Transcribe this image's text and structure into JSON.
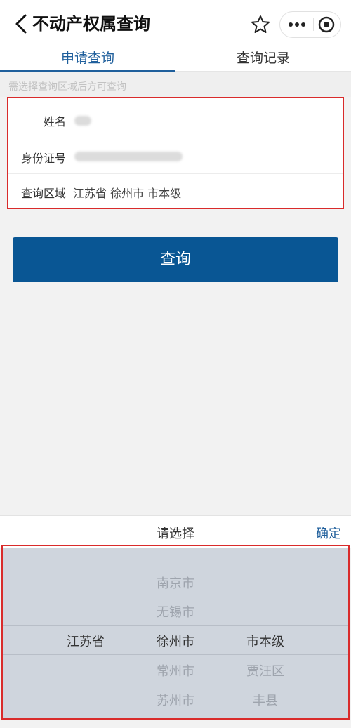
{
  "nav": {
    "title": "不动产权属查询",
    "back_icon": "back-arrow-icon",
    "favorite_icon": "star-icon",
    "more_icon": "more-dots-icon",
    "close_icon": "target-close-icon"
  },
  "tabs": [
    {
      "label": "申请查询",
      "active": true
    },
    {
      "label": "查询记录",
      "active": false
    }
  ],
  "hint": "需选择查询区域后方可查询",
  "form": {
    "name_label": "姓名",
    "id_label": "身份证号",
    "region_label": "查询区域",
    "region_value": "江苏省 徐州市 市本级"
  },
  "query_button": "查询",
  "picker": {
    "title": "请选择",
    "confirm": "确定",
    "col1": [
      "江苏省"
    ],
    "col2": [
      "南京市",
      "无锡市",
      "徐州市",
      "常州市",
      "苏州市"
    ],
    "col3": [
      "市本级",
      "贾汪区",
      "丰县"
    ]
  },
  "colors": {
    "accent": "#1f5f9c",
    "button": "#095694",
    "highlight": "#d92b2b",
    "picker_bg": "#cfd5dd"
  }
}
